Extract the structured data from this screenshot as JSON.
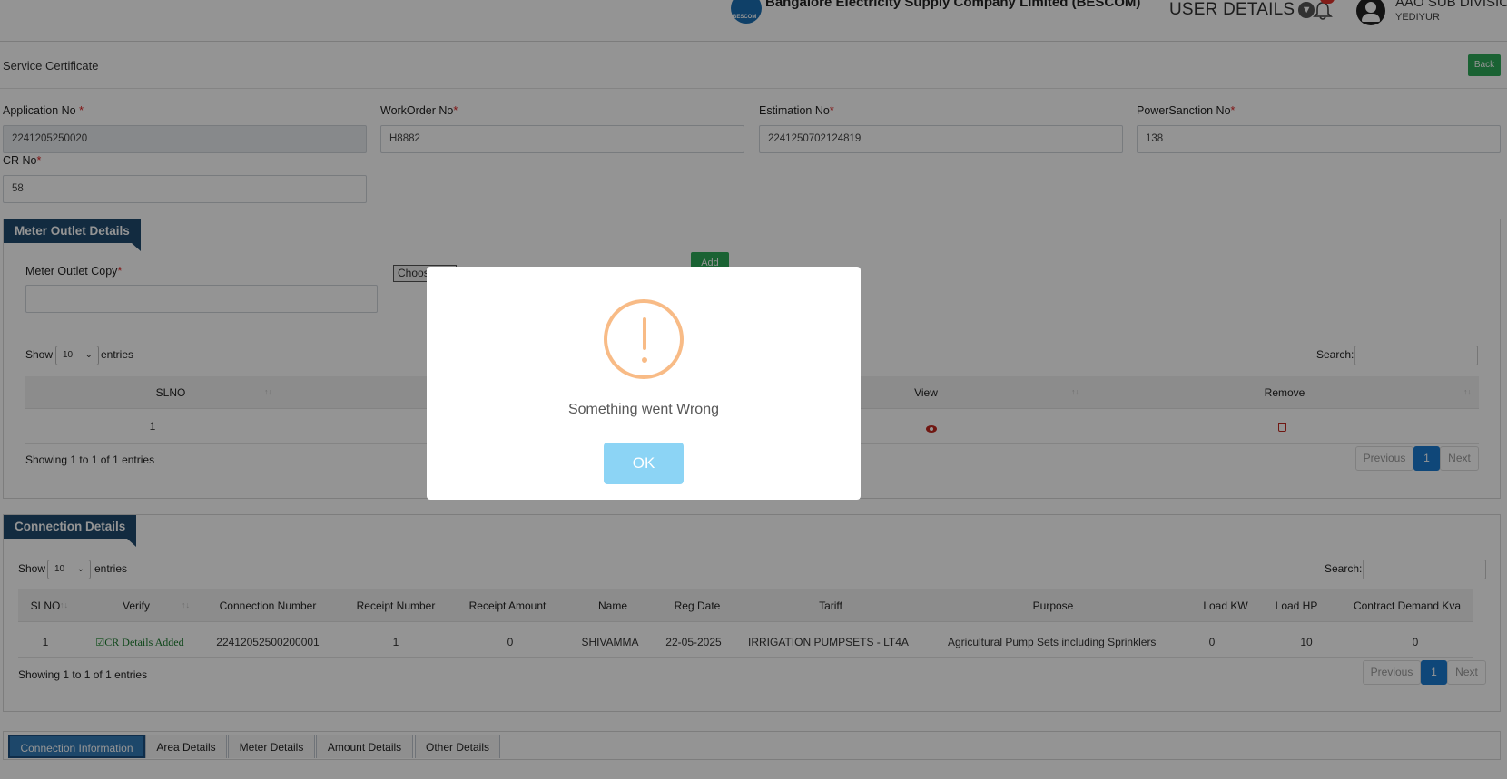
{
  "header": {
    "company": "Bangalore Electricity Supply Company Limited (BESCOM)",
    "logo_text": "BESCOM",
    "user_details": "USER DETAILS",
    "user_role": "AAO SUB DIVISIO",
    "user_sub": "YEDIYUR"
  },
  "page": {
    "title": "Service Certificate",
    "back_label": "Back"
  },
  "form": {
    "application_no": {
      "label": "Application No ",
      "value": "2241205250020"
    },
    "workorder_no": {
      "label": "WorkOrder No",
      "value": "H8882"
    },
    "estimation_no": {
      "label": "Estimation No",
      "value": "2241250702124819"
    },
    "powersanction_no": {
      "label": "PowerSanction No",
      "value": "138"
    },
    "cr_no": {
      "label": "CR No",
      "value": "58"
    },
    "required_mark": "*"
  },
  "meter_outlet": {
    "tab": "Meter Outlet Details",
    "copy_label": "Meter Outlet Copy",
    "choose_label": "Choos",
    "add_label": "Add",
    "show": "Show",
    "entries": "entries",
    "page_size": "10",
    "search_label": "Search:",
    "columns": [
      "SLNO",
      "View",
      "Remove"
    ],
    "rows": [
      {
        "slno": "1"
      }
    ],
    "info": "Showing 1 to 1 of 1 entries",
    "prev": "Previous",
    "page": "1",
    "next": "Next"
  },
  "connection": {
    "tab": "Connection Details",
    "show": "Show",
    "entries": "entries",
    "page_size": "10",
    "search_label": "Search:",
    "columns": [
      "SLNO",
      "Verify",
      "Connection Number",
      "Receipt Number",
      "Receipt Amount",
      "Name",
      "Reg Date",
      "Tariff",
      "Purpose",
      "Load KW",
      "Load HP",
      "Contract Demand Kva"
    ],
    "row": {
      "slno": "1",
      "verify": "CR Details Added",
      "connection_number": "22412052500200001",
      "receipt_number": "1",
      "receipt_amount": "0",
      "name": "SHIVAMMA",
      "reg_date": "22-05-2025",
      "tariff": "IRRIGATION PUMPSETS - LT4A",
      "purpose": "Agricultural Pump Sets including Sprinklers",
      "load_kw": "0",
      "load_hp": "10",
      "contract_demand": "0"
    },
    "info": "Showing 1 to 1 of 1 entries",
    "prev": "Previous",
    "page": "1",
    "next": "Next"
  },
  "bottom_tabs": [
    "Connection Information",
    "Area Details",
    "Meter Details",
    "Amount Details",
    "Other Details"
  ],
  "modal": {
    "message": "Something went Wrong",
    "ok_label": "OK"
  },
  "colors": {
    "accent_green": "#2eaa58",
    "panel_tab": "#1f4a6e",
    "warning": "#f8bb86",
    "ok_button": "#8cd4f5"
  }
}
